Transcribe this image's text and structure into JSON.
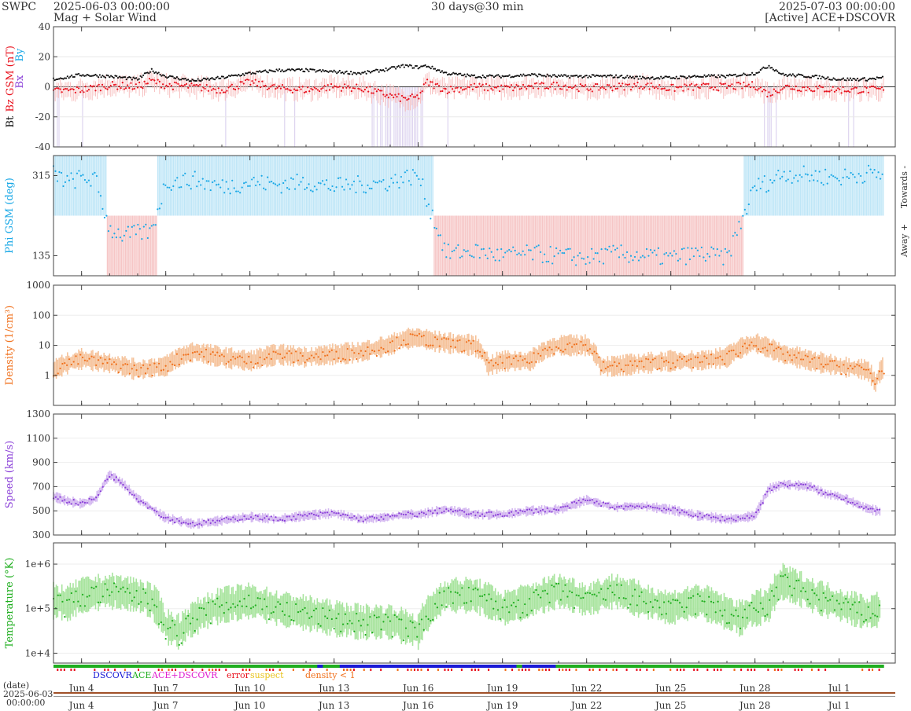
{
  "header": {
    "source": "SWPC",
    "start_time": "2025-06-03 00:00:00",
    "subtitle": "Mag + Solar Wind",
    "span": "30 days@30 min",
    "end_time": "2025-07-03 00:00:00",
    "active_source": "[Active] ACE+DSCOVR"
  },
  "colors": {
    "bt": "#111111",
    "bz": "#e8101c",
    "bx": "#8a3fd8",
    "by": "#1aa8e6",
    "phi": "#1aa8e6",
    "phi_toward_fill": "#bfe6f7",
    "phi_away_fill": "#f6c6c6",
    "density": "#f0701c",
    "density_band": "#f5c29a",
    "speed": "#8a3fd8",
    "speed_band": "#d3b6f0",
    "temperature": "#1fae1f",
    "temperature_band": "#a8e49e",
    "neg_bz_fill": "#ddd4ef",
    "dscovr": "#1a1ad6",
    "ace": "#1fae1f",
    "ace_dscovr": "#e020d0",
    "error": "#e8101c",
    "suspect": "#e8c21a",
    "density_lt1": "#f0701c"
  },
  "chart_data": [
    {
      "type": "scatter",
      "panel": "mag",
      "ylabel_parts": [
        "Bt",
        "Bz GSM (nT)",
        "Bx",
        "By"
      ],
      "ylim": [
        -40,
        40
      ],
      "yticks": [
        "40",
        "20",
        "0",
        "-20",
        "-40"
      ],
      "series": [
        {
          "name": "Bt",
          "x_day": [
            0,
            1,
            2,
            3,
            3.5,
            4,
            5,
            6,
            7,
            8,
            9,
            10,
            11,
            12,
            12.5,
            13,
            13.3,
            14,
            15,
            16,
            17,
            18,
            19,
            20,
            21,
            22,
            23,
            24,
            25,
            25.5,
            26,
            27,
            28,
            29,
            29.5
          ],
          "values": [
            5,
            8,
            7,
            5,
            11,
            7,
            4,
            6,
            9,
            11,
            11,
            10,
            9,
            12,
            14,
            13,
            14,
            9,
            7,
            7,
            8,
            7,
            7,
            7,
            6,
            6,
            7,
            7,
            9,
            14,
            8,
            7,
            5,
            5,
            6
          ]
        },
        {
          "name": "Bz",
          "x_day": [
            0,
            1,
            2,
            3,
            3.5,
            4,
            5,
            6,
            7,
            8,
            9,
            10,
            11,
            12,
            12.5,
            13,
            13.3,
            14,
            15,
            16,
            17,
            18,
            19,
            20,
            21,
            22,
            23,
            24,
            25,
            25.5,
            26,
            27,
            28,
            29,
            29.5
          ],
          "values": [
            -3,
            -2,
            1,
            0,
            4,
            1,
            0,
            -2,
            3,
            -1,
            -2,
            0,
            -1,
            -6,
            -8,
            -7,
            3,
            -2,
            0,
            -1,
            0,
            1,
            -1,
            0,
            1,
            -1,
            0,
            0,
            1,
            -5,
            0,
            -1,
            -2,
            -2,
            -2
          ]
        }
      ]
    },
    {
      "type": "scatter",
      "panel": "phi",
      "ylabel": "Phi GSM (deg)",
      "ylim": [
        90,
        360
      ],
      "yticks": [
        "315",
        "135"
      ],
      "right_labels": [
        "Towards -",
        "Away +"
      ],
      "x_day": [
        0,
        0.5,
        1,
        1.5,
        2,
        2.5,
        3,
        3.5,
        4,
        5,
        6,
        7,
        8,
        9,
        10,
        11,
        12,
        12.5,
        13,
        14,
        15,
        16,
        17,
        18,
        19,
        20,
        21,
        22,
        23,
        24,
        25,
        25.5,
        26,
        27,
        28,
        29,
        29.5
      ],
      "values": [
        320,
        300,
        310,
        305,
        195,
        180,
        185,
        190,
        300,
        305,
        290,
        300,
        295,
        300,
        290,
        295,
        300,
        310,
        315,
        140,
        145,
        135,
        140,
        135,
        130,
        140,
        135,
        130,
        140,
        130,
        290,
        300,
        320,
        315,
        310,
        320,
        315
      ]
    },
    {
      "type": "area",
      "panel": "density",
      "ylabel": "Density (1/cm³)",
      "yscale": "log",
      "ylim": [
        0.1,
        1000
      ],
      "yticks": [
        "1000",
        "100",
        "10",
        "1"
      ],
      "x_day": [
        0,
        0.5,
        1,
        2,
        3,
        4,
        5,
        6,
        7,
        8,
        9,
        10,
        11,
        12,
        12.5,
        13,
        13.5,
        14,
        15,
        15.5,
        16,
        17,
        18,
        19,
        19.5,
        20,
        21,
        22,
        23,
        24,
        25,
        25.5,
        26,
        27,
        28,
        29,
        29.3,
        29.6
      ],
      "values": [
        1.5,
        2.5,
        3.5,
        2.5,
        1.5,
        2,
        6,
        4,
        3,
        5,
        4,
        5,
        6,
        10,
        16,
        18,
        14,
        12,
        10,
        2,
        3,
        3,
        10,
        10,
        2,
        2,
        2.5,
        3,
        3,
        4,
        12,
        8,
        5,
        3,
        2,
        1.5,
        0.5,
        2
      ]
    },
    {
      "type": "area",
      "panel": "speed",
      "ylabel": "Speed (km/s)",
      "ylim": [
        300,
        1300
      ],
      "yticks": [
        "1300",
        "1100",
        "900",
        "700",
        "500",
        "300"
      ],
      "x_day": [
        0,
        0.5,
        1,
        1.5,
        2,
        2.5,
        3,
        3.5,
        4,
        5,
        6,
        7,
        8,
        9,
        10,
        11,
        12,
        12.5,
        13,
        14,
        15,
        16,
        17,
        18,
        19,
        20,
        21,
        22,
        23,
        24,
        24.5,
        25,
        25.5,
        26,
        27,
        27.5,
        28,
        29,
        29.5
      ],
      "values": [
        620,
        580,
        560,
        600,
        800,
        720,
        600,
        520,
        440,
        390,
        420,
        450,
        430,
        460,
        480,
        430,
        450,
        470,
        470,
        510,
        470,
        470,
        500,
        510,
        590,
        530,
        540,
        510,
        460,
        430,
        440,
        460,
        680,
        720,
        700,
        640,
        620,
        520,
        490
      ]
    },
    {
      "type": "area",
      "panel": "temperature",
      "ylabel": "Temperature (°K)",
      "yscale": "log",
      "ylim": [
        6000,
        3000000
      ],
      "yticks": [
        "1e+6",
        "1e+5",
        "1e+4"
      ],
      "x_day": [
        0,
        0.5,
        1,
        2,
        3,
        3.5,
        4,
        4.5,
        5,
        6,
        7,
        8,
        9,
        10,
        11,
        12,
        12.5,
        13,
        13.5,
        14,
        15,
        16,
        17,
        18,
        19,
        20,
        21,
        22,
        23,
        24,
        24.5,
        25,
        25.5,
        26,
        27,
        28,
        29,
        29.5
      ],
      "values": [
        150000,
        130000,
        200000,
        250000,
        200000,
        150000,
        40000,
        30000,
        60000,
        120000,
        150000,
        100000,
        80000,
        60000,
        50000,
        50000,
        40000,
        30000,
        100000,
        200000,
        200000,
        100000,
        150000,
        250000,
        150000,
        250000,
        150000,
        100000,
        150000,
        80000,
        60000,
        100000,
        120000,
        400000,
        200000,
        120000,
        80000,
        100000
      ]
    }
  ],
  "x_axis": {
    "tick_labels": [
      "Jun 4",
      "Jun 7",
      "Jun 10",
      "Jun 13",
      "Jun 16",
      "Jun 19",
      "Jun 22",
      "Jun 25",
      "Jun 28",
      "Jul 1"
    ],
    "tick_days": [
      1,
      4,
      7,
      10,
      13,
      16,
      19,
      22,
      25,
      28
    ],
    "range_days": [
      0,
      30
    ]
  },
  "source_bar": {
    "legend": [
      "DSCOVR",
      "ACE",
      "ACE+DSCOVR",
      "error",
      "suspect",
      "density < 1"
    ],
    "dscovr_segments_day": [
      [
        9.4,
        9.6
      ],
      [
        10.2,
        16.5
      ],
      [
        16.7,
        17.9
      ]
    ]
  },
  "footer": {
    "date_label": "(date)",
    "date_value": "2025-06-03",
    "time_value": "00:00:00"
  }
}
